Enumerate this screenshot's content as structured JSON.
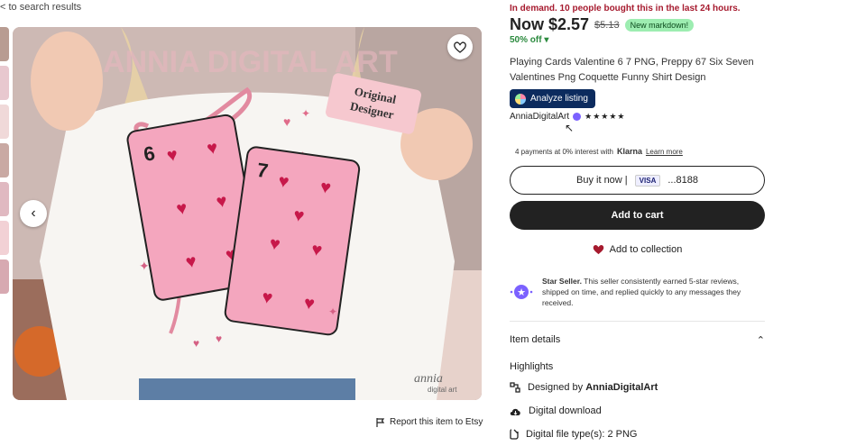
{
  "nav": {
    "back_label": "< to search results"
  },
  "product": {
    "demand": "In demand. 10 people bought this in the last 24 hours.",
    "price": "Now $2.57",
    "old_price": "$5.13",
    "markdown": "New markdown!",
    "discount": "50% off",
    "title": "Playing Cards Valentine 6 7 PNG, Preppy 67 Six Seven Valentines Png Coquette Funny Shirt Design",
    "analyze_label": "Analyze listing",
    "seller_name": "AnniaDigitalArt",
    "stars": "★★★★★",
    "klarna_prefix": "4 payments at 0% interest with",
    "klarna_brand": "Klarna",
    "klarna_link": "Learn more",
    "buy_now": "Buy it now |",
    "card_brand": "VISA",
    "card_last": "...8188",
    "add_to_cart": "Add to cart",
    "add_collection": "Add to collection",
    "star_seller_title": "Star Seller.",
    "star_seller_text": "This seller consistently earned 5-star reviews, shipped on time, and replied quickly to any messages they received.",
    "item_details": "Item details",
    "highlights_title": "Highlights",
    "highlights": [
      {
        "prefix": "Designed by",
        "value": "AnniaDigitalArt",
        "icon": "designer-icon"
      },
      {
        "prefix": "Digital download",
        "value": "",
        "icon": "cloud-download-icon"
      },
      {
        "prefix": "Digital file type(s): 2 PNG",
        "value": "",
        "icon": "file-icon"
      }
    ],
    "report": "Report this item to Etsy"
  },
  "image": {
    "watermark": "ANNIA DIGITAL ART",
    "badge_line1": "Original",
    "badge_line2": "Designer",
    "card1_rank": "6",
    "card2_rank": "7",
    "logo_line1": "annia",
    "logo_line2": "digital art"
  },
  "colors": {
    "accent_green": "#2b8a3e",
    "demand_red": "#a61a2e",
    "analyze_blue": "#0c2b5e"
  }
}
